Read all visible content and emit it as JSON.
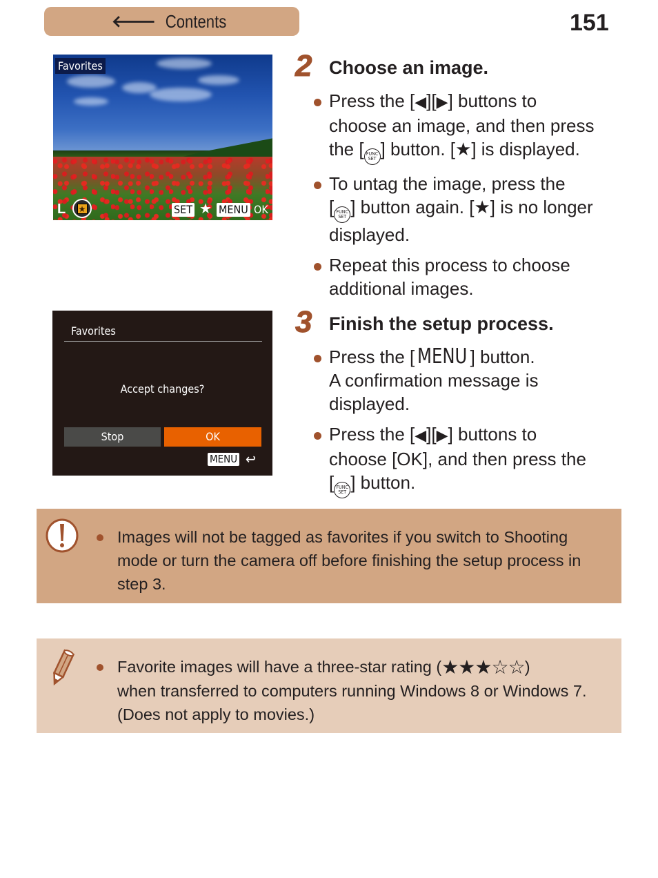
{
  "header": {
    "contents_label": "Contents",
    "back_arrow_icon": "arrow-left-icon",
    "page_number": "151"
  },
  "screens": {
    "photo": {
      "title": "Favorites",
      "size_label": "L",
      "set_key": "SET",
      "star": "★",
      "menu_key": "MENU",
      "ok_label": "OK"
    },
    "dialog": {
      "title": "Favorites",
      "message": "Accept changes?",
      "stop_label": "Stop",
      "ok_label": "OK",
      "menu_key": "MENU",
      "back_icon": "↩"
    }
  },
  "steps": [
    {
      "number": "2",
      "title": "Choose an image.",
      "bullets": [
        {
          "parts": [
            "Press the [",
            "◀",
            "][",
            "▶",
            "] buttons to",
            "choose an image, and then press",
            "the [",
            "] button. [",
            "★",
            "] is displayed."
          ]
        },
        {
          "parts": [
            "To untag the image, press the",
            "[",
            "] button again. [",
            "★",
            "] is no longer",
            "displayed."
          ]
        },
        {
          "parts": [
            "Repeat this process to choose",
            "additional images."
          ]
        }
      ]
    },
    {
      "number": "3",
      "title": "Finish the setup process.",
      "bullets": [
        {
          "parts": [
            "Press the [",
            "MENU",
            "] button.",
            "A confirmation message is",
            "displayed."
          ]
        },
        {
          "parts": [
            "Press the [",
            "◀",
            "][",
            "▶",
            "] buttons to",
            "choose [OK], and then press the",
            "[",
            "] button."
          ]
        }
      ]
    }
  ],
  "func_set": {
    "top": "FUNC",
    "bottom": "SET"
  },
  "notes": {
    "caution": {
      "icon": "exclamation-icon",
      "lines": [
        "Images will not be tagged as favorites if you switch to Shooting",
        "mode or turn the camera off before finishing the setup process in",
        "step 3."
      ]
    },
    "memo": {
      "icon": "pencil-icon",
      "line1_prefix": "Favorite images will have a three-star rating (",
      "rating": {
        "filled": 3,
        "total": 5,
        "filled_glyph": "★★★",
        "empty_glyph": "☆☆"
      },
      "line1_suffix": ")",
      "lines": [
        "when transferred to computers running Windows 8 or Windows 7.",
        "(Does not apply to movies.)"
      ]
    }
  },
  "colors": {
    "accent_brown": "#a0522d",
    "contents_bg": "#d2a683",
    "caution_bg": "#d2a683",
    "memo_bg": "#e6cdb9",
    "dialog_bg": "#231815",
    "ok_orange": "#e86100",
    "stop_gray": "#4a4a48"
  }
}
